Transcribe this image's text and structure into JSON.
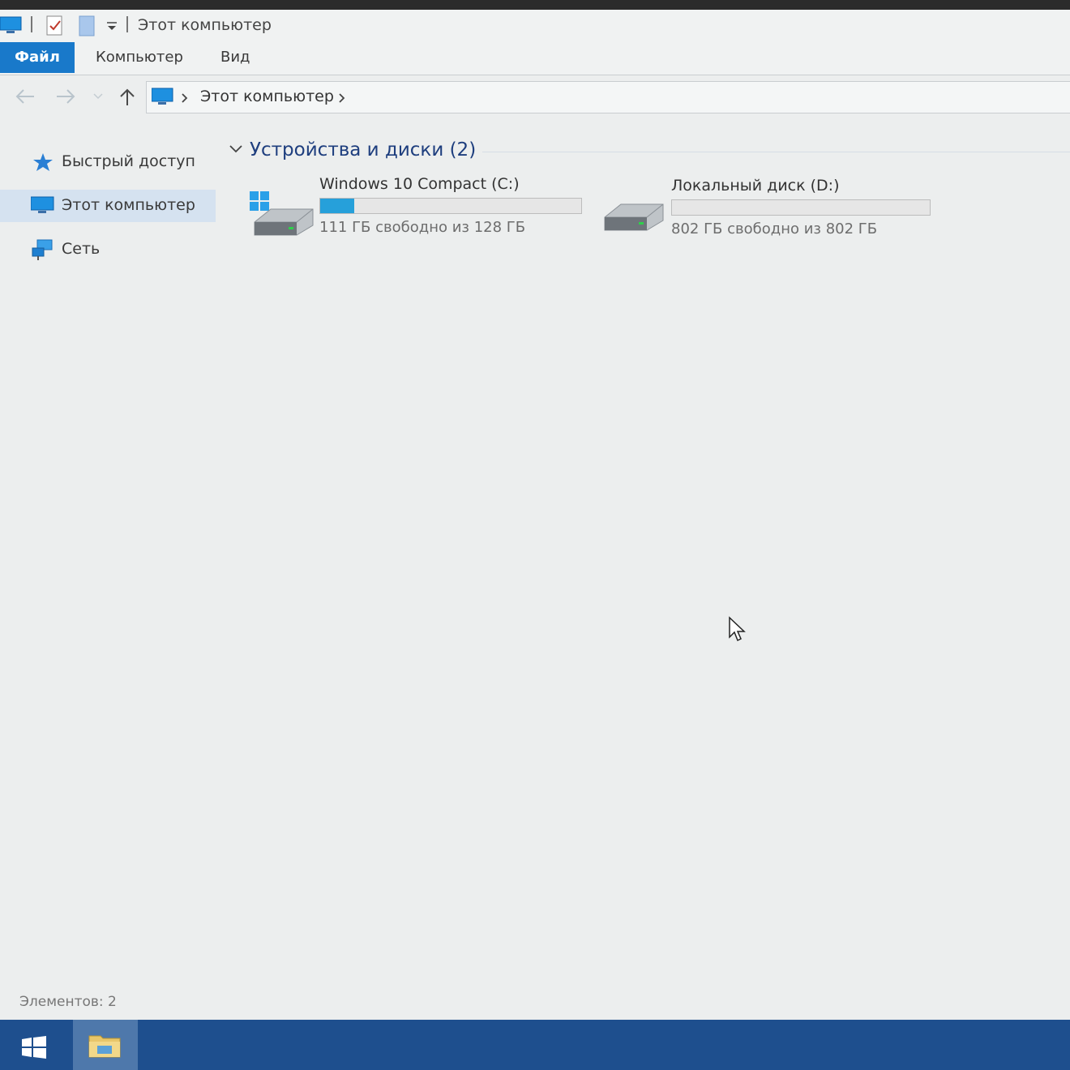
{
  "window": {
    "title": "Этот компьютер"
  },
  "ribbon": {
    "tabs": [
      {
        "label": "Файл"
      },
      {
        "label": "Компьютер"
      },
      {
        "label": "Вид"
      }
    ]
  },
  "address_bar": {
    "path": "Этот компьютер"
  },
  "sidebar": {
    "items": [
      {
        "label": "Быстрый доступ",
        "icon": "star-icon",
        "selected": false
      },
      {
        "label": "Этот компьютер",
        "icon": "computer-icon",
        "selected": true
      },
      {
        "label": "Сеть",
        "icon": "network-icon",
        "selected": false
      }
    ]
  },
  "main": {
    "group_title": "Устройства и диски (2)",
    "drives": [
      {
        "name": "Windows 10 Compact  (C:)",
        "free_text": "111 ГБ свободно из 128 ГБ",
        "used_fraction": 0.13,
        "icon": "system-drive-icon"
      },
      {
        "name": "Локальный диск (D:)",
        "free_text": "802 ГБ свободно из 802 ГБ",
        "used_fraction": 0.0,
        "icon": "local-drive-icon"
      }
    ]
  },
  "status_bar": {
    "items_text": "Элементов: 2"
  },
  "colors": {
    "accent": "#1979ca",
    "progress": "#26a0da",
    "taskbar": "#1e4f8e",
    "selected": "#d5e2f0"
  }
}
